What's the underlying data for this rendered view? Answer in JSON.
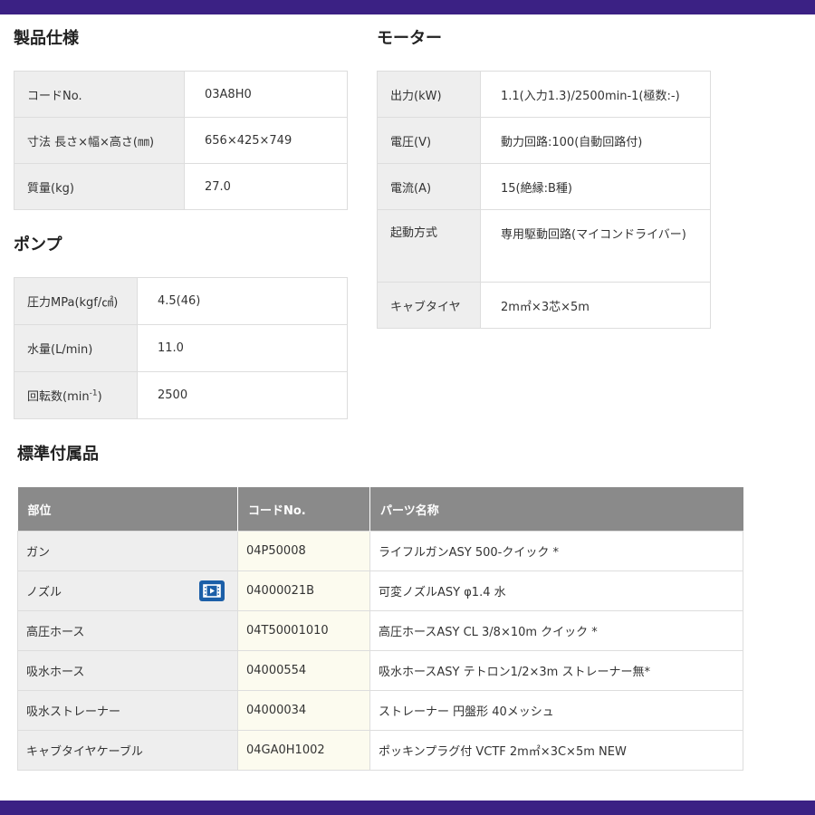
{
  "sections": {
    "spec_title": "製品仕様",
    "motor_title": "モーター",
    "pump_title": "ポンプ",
    "accessories_title": "標準付属品"
  },
  "spec": [
    {
      "label": "コードNo.",
      "value": "03A8H0"
    },
    {
      "label": "寸法 長さ×幅×高さ(㎜)",
      "value": "656×425×749"
    },
    {
      "label": "質量(kg)",
      "value": "27.0"
    }
  ],
  "pump": {
    "pressure": {
      "label": "圧力MPa(kgf/㎠)",
      "value": "4.5(46)"
    },
    "flow": {
      "label": "水量(L/min)",
      "value": "11.0"
    },
    "speed": {
      "label_main": "回転数(min",
      "label_sup": "-1",
      "label_end": ")",
      "value": "2500"
    }
  },
  "motor": [
    {
      "label": "出力(kW)",
      "value": "1.1(入力1.3)/2500min-1(極数:-)"
    },
    {
      "label": "電圧(V)",
      "value": "動力回路:100(自動回路付)"
    },
    {
      "label": "電流(A)",
      "value": "15(絶縁:B種)"
    },
    {
      "label": "起動方式",
      "value": "専用駆動回路(マイコンドライバー)"
    },
    {
      "label": "キャブタイヤ",
      "value": "2m㎡×3芯×5m"
    }
  ],
  "accessories": {
    "headers": [
      "部位",
      "コードNo.",
      "パーツ名称"
    ],
    "rows": [
      {
        "part": "ガン",
        "code": "04P50008",
        "name": "ライフルガンASY 500-クイック *"
      },
      {
        "part": "ノズル",
        "code": "04000021B",
        "name": "可変ノズルASY φ1.4 水",
        "icon": "movie-icon"
      },
      {
        "part": "高圧ホース",
        "code": "04T50001010",
        "name": "高圧ホースASY CL 3/8×10m クイック *"
      },
      {
        "part": "吸水ホース",
        "code": "04000554",
        "name": "吸水ホースASY テトロン1/2×3m ストレーナー無*"
      },
      {
        "part": "吸水ストレーナー",
        "code": "04000034",
        "name": "ストレーナー 円盤形 40メッシュ"
      },
      {
        "part": "キャブタイヤケーブル",
        "code": "04GA0H1002",
        "name": "ポッキンプラグ付 VCTF 2m㎡×3C×5m NEW"
      }
    ]
  },
  "colors": {
    "band": "#3b2184",
    "header_bg": "#8a8a8a",
    "label_bg": "#eeeeee",
    "code_bg": "#fcfbef",
    "icon": "#1c5fa8"
  }
}
